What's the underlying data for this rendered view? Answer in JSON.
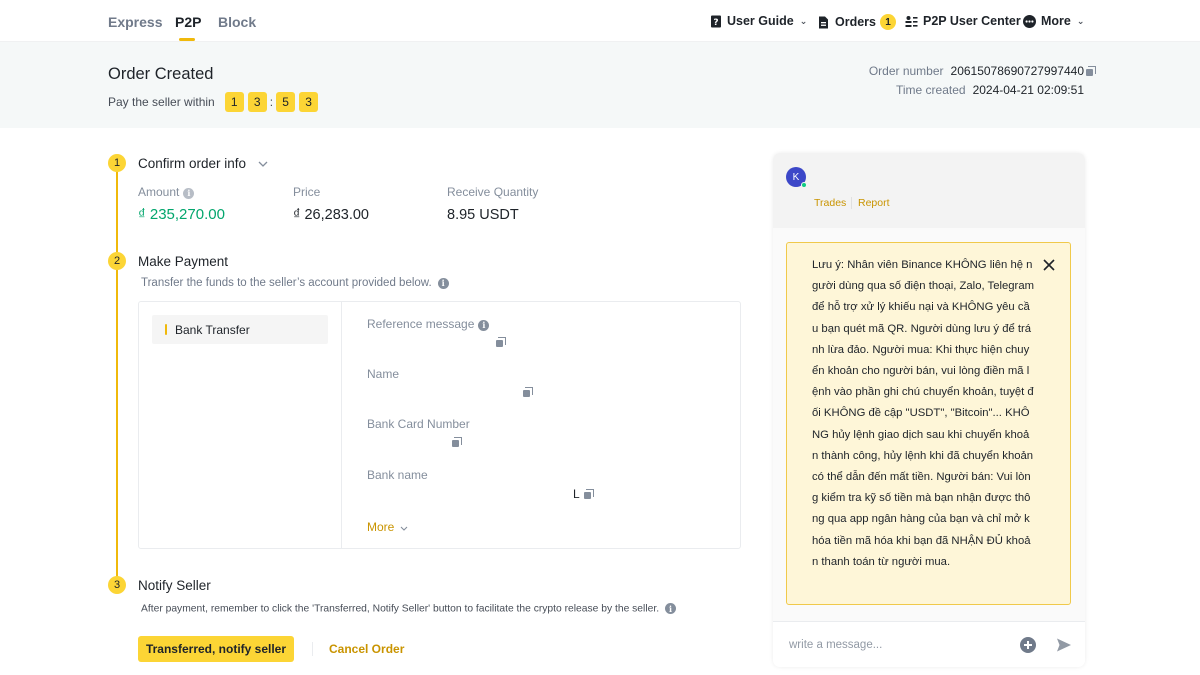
{
  "nav": {
    "tabs": [
      {
        "label": "Express",
        "active": false
      },
      {
        "label": "P2P",
        "active": true
      },
      {
        "label": "Block",
        "active": false
      }
    ],
    "right": {
      "user_guide": "User Guide",
      "orders": "Orders",
      "orders_count": "1",
      "p2p_user_center": "P2P User Center",
      "more": "More"
    }
  },
  "header": {
    "title": "Order Created",
    "pay_within_label": "Pay the seller within",
    "countdown": [
      "1",
      "3",
      "5",
      "3"
    ],
    "countdown_sep": ":",
    "order_number_label": "Order number",
    "order_number": "20615078690727997440",
    "time_created_label": "Time created",
    "time_created": "2024-04-21 02:09:51"
  },
  "steps": {
    "confirm": {
      "num": "1",
      "title": "Confirm order info",
      "amount_label": "Amount",
      "amount": "₫ 235,270.00",
      "price_label": "Price",
      "price": "₫ 26,283.00",
      "qty_label": "Receive Quantity",
      "qty": "8.95 USDT"
    },
    "payment": {
      "num": "2",
      "title": "Make Payment",
      "desc": "Transfer the funds to the seller’s account provided below.",
      "method": "Bank Transfer",
      "fields": [
        {
          "label": "Reference message",
          "value": ""
        },
        {
          "label": "Name",
          "value": ""
        },
        {
          "label": "Bank Card Number",
          "value": ""
        },
        {
          "label": "Bank name",
          "value": "L"
        }
      ],
      "more": "More"
    },
    "notify": {
      "num": "3",
      "title": "Notify Seller",
      "desc": "After payment, remember to click the 'Transferred, Notify Seller' button to facilitate the crypto release by the seller.",
      "primary_button": "Transferred, notify seller",
      "cancel": "Cancel Order"
    }
  },
  "chat": {
    "avatar_initial": "K",
    "trades": "Trades",
    "report": "Report",
    "notice": "Lưu ý: Nhân viên Binance KHÔNG liên hệ người dùng qua số điện thoại, Zalo, Telegram để hỗ trợ xử lý khiếu nại và KHÔNG yêu cầu bạn quét mã QR. Người dùng lưu ý để tránh lừa đảo. Người mua: Khi thực hiện chuyển khoản cho người bán, vui lòng điền mã lệnh vào phần ghi chú chuyển khoản, tuyệt đối KHÔNG đề cập \"USDT\", \"Bitcoin\"... KHÔNG hủy lệnh giao dịch sau khi chuyển khoản thành công, hủy lệnh khi đã chuyển khoản có thể dẫn đến mất tiền. Người bán: Vui lòng kiểm tra kỹ số tiền mà bạn nhận được thông qua app ngân hàng của bạn và chỉ mở khóa tiền mã hóa khi bạn đã NHẬN ĐỦ khoản thanh toán từ người mua.",
    "input_placeholder": "write a message..."
  },
  "colors": {
    "accent": "#fcd535",
    "link": "#c99400",
    "amount_green": "#03a66d",
    "notice_bg": "#fef6d8"
  }
}
